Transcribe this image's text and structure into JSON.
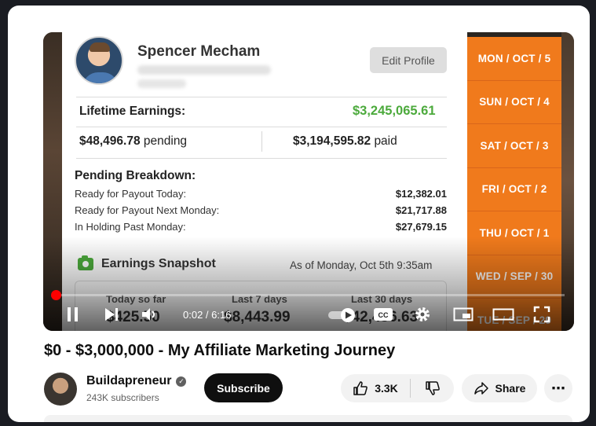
{
  "video": {
    "profile": {
      "name": "Spencer Mecham",
      "edit_label": "Edit Profile",
      "lifetime_label": "Lifetime Earnings:",
      "lifetime_value": "$3,245,065.61",
      "pending_amount": "$48,496.78",
      "pending_word": "pending",
      "paid_amount": "$3,194,595.82",
      "paid_word": "paid",
      "breakdown_title": "Pending Breakdown:",
      "breakdown": [
        {
          "label": "Ready for Payout Today:",
          "value": "$12,382.01"
        },
        {
          "label": "Ready for Payout Next Monday:",
          "value": "$21,717.88"
        },
        {
          "label": "In Holding Past Monday:",
          "value": "$27,679.15"
        }
      ],
      "snapshot_title": "Earnings Snapshot",
      "snapshot_asof": "As of Monday, Oct 5th 9:35am",
      "stats": [
        {
          "label": "Today so far",
          "value": "$425.50"
        },
        {
          "label": "Last 7 days",
          "value": "$8,443.99"
        },
        {
          "label": "Last 30 days",
          "value": "$42,456.63"
        }
      ]
    },
    "dates": [
      "MON / OCT / 5",
      "SUN / OCT / 4",
      "SAT / OCT / 3",
      "FRI / OCT / 2",
      "THU / OCT / 1",
      "WED / SEP / 30",
      "TUE / SEP / 29"
    ],
    "player": {
      "time": "0:02 / 6:16",
      "progress": 0.005,
      "cc_label": "CC",
      "icons": [
        "pause-icon",
        "next-icon",
        "volume-icon",
        "autoplay-toggle",
        "cc-icon",
        "settings-icon",
        "miniplayer-icon",
        "theater-icon",
        "fullscreen-icon"
      ]
    }
  },
  "title": "$0 - $3,000,000 - My Affiliate Marketing Journey",
  "channel": {
    "name": "Buildapreneur",
    "subscribers": "243K subscribers",
    "subscribe_label": "Subscribe"
  },
  "actions": {
    "likes": "3.3K",
    "share_label": "Share",
    "more_label": "⋯"
  },
  "colors": {
    "accent_orange": "#f07a1c",
    "earnings_green": "#4caa3c",
    "progress_red": "#ff0000"
  }
}
